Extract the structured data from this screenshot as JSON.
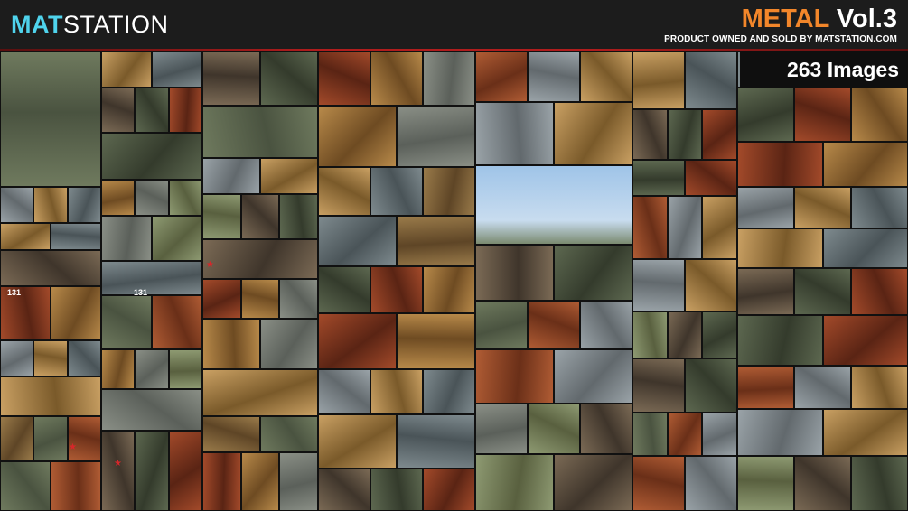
{
  "brand": {
    "mat": "MAT",
    "station": "STATION"
  },
  "title": {
    "metal": "METAL",
    "vol": "Vol.3"
  },
  "subtitle": "PRODUCT OWNED AND SOLD BY MATSTATION.COM",
  "badge": {
    "label": "263 Images"
  },
  "tank_numbers": [
    "131",
    "131"
  ],
  "colors": {
    "brand_accent": "#4fd3ec",
    "metal_accent": "#f2862a",
    "divider_red": "#b01d1d"
  }
}
